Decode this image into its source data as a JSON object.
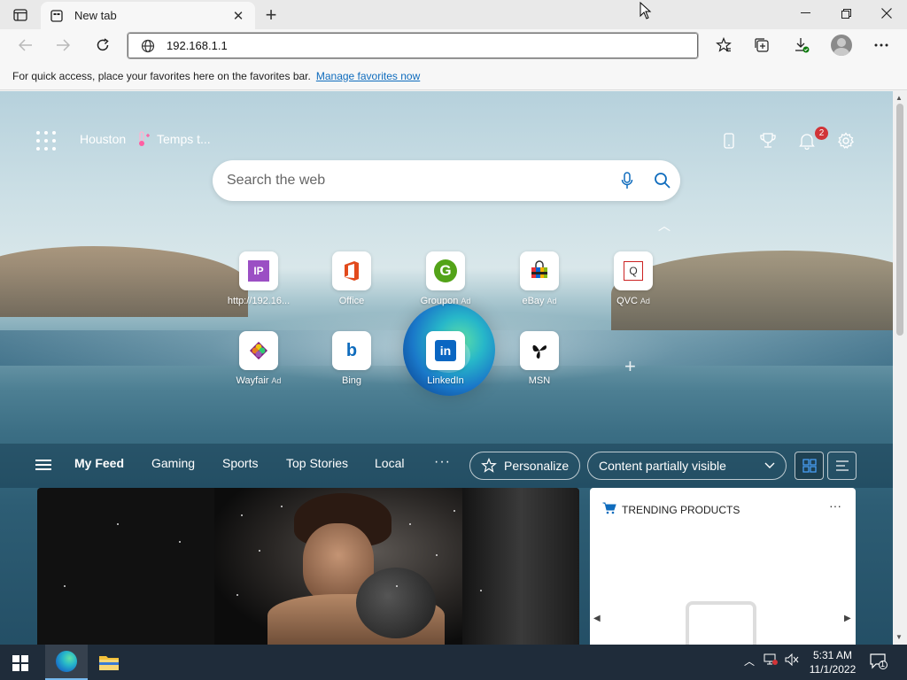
{
  "browser": {
    "tab_title": "New tab",
    "address": "192.168.1.1",
    "favorites_bar": {
      "message": "For quick access, place your favorites here on the favorites bar.",
      "link": "Manage favorites now"
    }
  },
  "ntp": {
    "weather_city": "Houston",
    "weather_temp": "Temps t...",
    "notification_count": "2",
    "search_placeholder": "Search the web",
    "quick_links": [
      {
        "label": "http://192.16...",
        "ad": "",
        "icon": "IP"
      },
      {
        "label": "Office",
        "ad": "",
        "icon": "office-icon"
      },
      {
        "label": "Groupon",
        "ad": "Ad",
        "icon": "G"
      },
      {
        "label": "eBay",
        "ad": "Ad",
        "icon": "ebay-bag-icon"
      },
      {
        "label": "QVC",
        "ad": "Ad",
        "icon": "Q"
      },
      {
        "label": "Wayfair",
        "ad": "Ad",
        "icon": "wayfair-icon"
      },
      {
        "label": "Bing",
        "ad": "",
        "icon": "b"
      },
      {
        "label": "LinkedIn",
        "ad": "",
        "icon": "in"
      },
      {
        "label": "MSN",
        "ad": "",
        "icon": "msn-butterfly-icon"
      }
    ],
    "feed_tabs": [
      "My Feed",
      "Gaming",
      "Sports",
      "Top Stories",
      "Local"
    ],
    "more": "···",
    "personalize": "Personalize",
    "content_visibility": "Content partially visible",
    "trending_title": "TRENDING PRODUCTS"
  },
  "taskbar": {
    "time": "5:31 AM",
    "date": "11/1/2022",
    "notification_count": "1"
  },
  "colors": {
    "accent": "#0f6cbd",
    "badge": "#d13438",
    "taskbar": "#1f2c3a"
  }
}
